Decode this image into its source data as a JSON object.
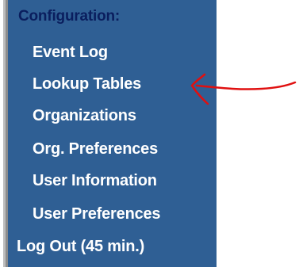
{
  "sidebar": {
    "heading": "Configuration:",
    "items": [
      {
        "label": "Event Log"
      },
      {
        "label": "Lookup Tables"
      },
      {
        "label": "Organizations"
      },
      {
        "label": "Org. Preferences"
      },
      {
        "label": "User Information"
      },
      {
        "label": "User Preferences"
      }
    ],
    "logout_label": "Log Out (45 min.)"
  },
  "colors": {
    "panel_background": "#2f5f94",
    "heading_text": "#0a1e5e",
    "item_text": "#ffffff",
    "annotation_arrow": "#e01010"
  },
  "annotation": {
    "type": "hand-drawn-arrow",
    "points_to": "Lookup Tables"
  }
}
